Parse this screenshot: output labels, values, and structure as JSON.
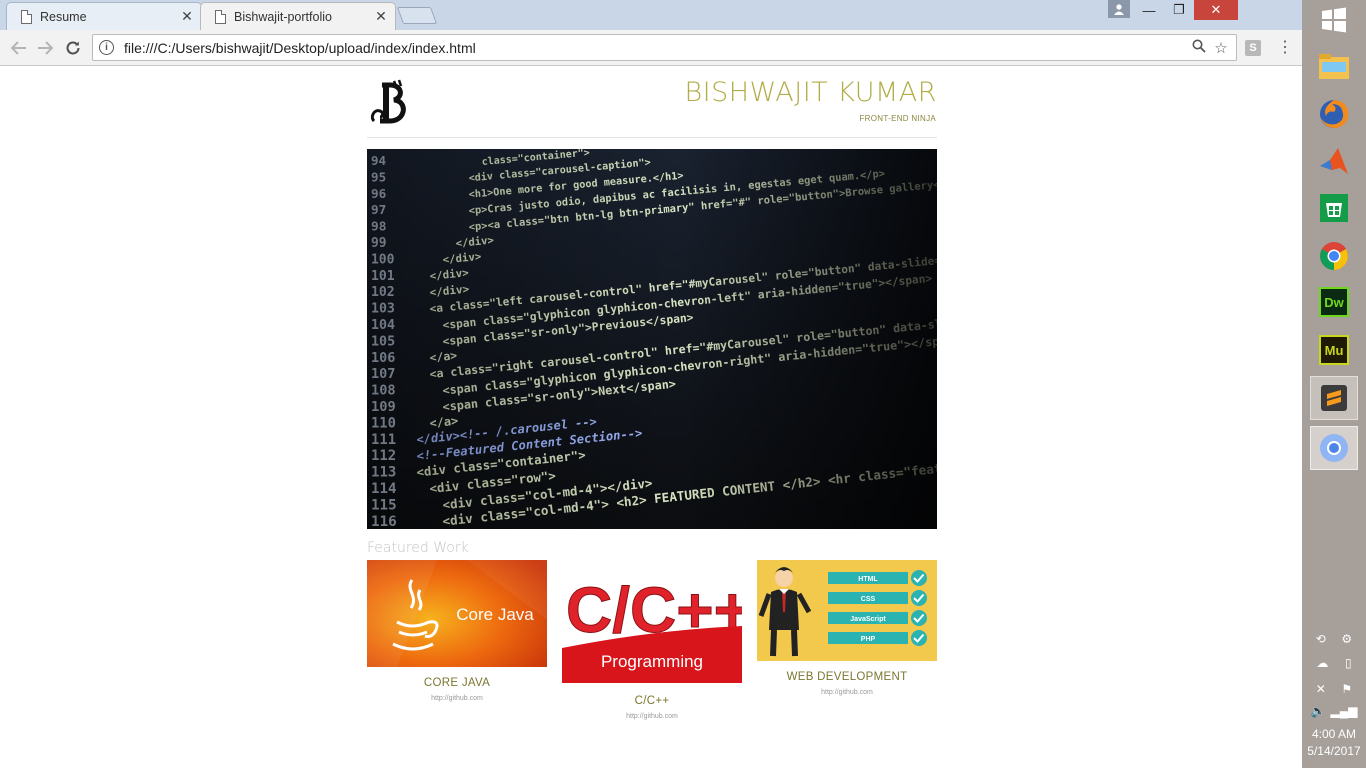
{
  "browser": {
    "tabs": [
      {
        "title": "Resume",
        "close": "✕"
      },
      {
        "title": "Bishwajit-portfolio",
        "close": "✕"
      }
    ],
    "address": "file:///C:/Users/bishwajit/Desktop/upload/index/index.html",
    "extension_label": "S",
    "window_controls": {
      "minimize": "—",
      "restore": "❐",
      "close": "✕"
    }
  },
  "site": {
    "title": "BISHWAJIT KUMAR",
    "subtitle": "FRONT-END NINJA",
    "featured_heading": "Featured Work",
    "works": [
      {
        "title": "CORE JAVA",
        "link": "http://github.com",
        "thumb_text": "Core Java"
      },
      {
        "title": "C/C++",
        "link": "http://github.com",
        "thumb_text": "C/C++",
        "thumb_sub": "Programming"
      },
      {
        "title": "WEB DEVELOPMENT",
        "link": "http://github.com",
        "skills": [
          "HTML",
          "CSS",
          "JavaScript",
          "PHP"
        ]
      }
    ]
  },
  "hero_code": {
    "line_numbers": [
      "94",
      "95",
      "96",
      "97",
      "98",
      "99",
      "100",
      "101",
      "102",
      "103",
      "104",
      "105",
      "106",
      "107",
      "108",
      "109",
      "110",
      "111",
      "112",
      "113",
      "114",
      "115",
      "116"
    ],
    "lines": [
      "class=\"container\">",
      "<div class=\"carousel-caption\">",
      "<h1>One more for good measure.</h1>",
      "<p>Cras justo odio, dapibus ac facilisis in, egestas eget quam.</p>",
      "<p><a class=\"btn btn-lg btn-primary\" href=\"#\" role=\"button\">Browse gallery</a></p>",
      "</div>",
      "</div>",
      "</div>",
      "</div>",
      "<a class=\"left carousel-control\" href=\"#myCarousel\" role=\"button\" data-slide=\"prev\">",
      "<span class=\"glyphicon glyphicon-chevron-left\" aria-hidden=\"true\"></span>",
      "<span class=\"sr-only\">Previous</span>",
      "</a>",
      "<a class=\"right carousel-control\" href=\"#myCarousel\" role=\"button\" data-slide=\"next\">",
      "<span class=\"glyphicon glyphicon-chevron-right\" aria-hidden=\"true\"></span>",
      "<span class=\"sr-only\">Next</span>",
      "</a>",
      "</div><!-- /.carousel -->",
      "<!--Featured Content Section-->",
      "<div class=\"container\">",
      "<div class=\"row\">",
      "<div class=\"col-md-4\"></div>",
      "<div class=\"col-md-4\"> <h2> FEATURED CONTENT </h2> <hr class=\"featurette-divider\">"
    ]
  },
  "taskbar": {
    "time": "4:00 AM",
    "date": "5/14/2017",
    "apps": [
      "file-explorer",
      "firefox",
      "matlab",
      "store",
      "chrome",
      "dreamweaver",
      "muse",
      "sublime-text",
      "chrome-active"
    ],
    "dw_label": "Dw",
    "mu_label": "Mu"
  }
}
